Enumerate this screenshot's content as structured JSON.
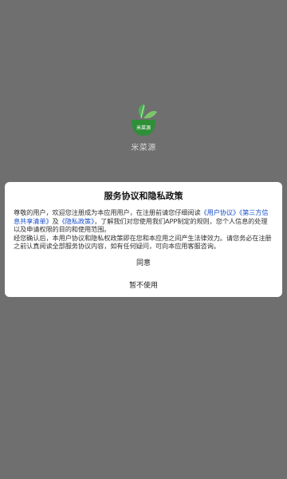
{
  "app": {
    "name": "米菜源",
    "logo_text": "米菜源",
    "logo_icon": "leaf-bowl-logo"
  },
  "dialog": {
    "title": "服务协议和隐私政策",
    "para1_prefix": "尊敬的用户，欢迎您注册成为本应用用户，在注册前请您仔细阅读",
    "link_user_agreement": "《用户协议》",
    "link_third_party": "《第三方信息共享清单》",
    "and": "及",
    "link_privacy": "《隐私政策》",
    "para1_suffix": "，了解我们对您使用我们APP制定的规则，您个人信息的处理以及申请权限的目的和使用范围。",
    "para2": "经您确认后，本用户协议和隐私权政策即在您和本应用之间产生法律效力。请您务必在注册之前认真阅读全部服务协议内容，如有任何疑问，可向本应用客服咨询。",
    "agree_label": "同意",
    "decline_label": "暂不使用"
  },
  "colors": {
    "overlay": "#6f6f6f",
    "link": "#1a4fc9",
    "logo_green": "#3fa344"
  }
}
